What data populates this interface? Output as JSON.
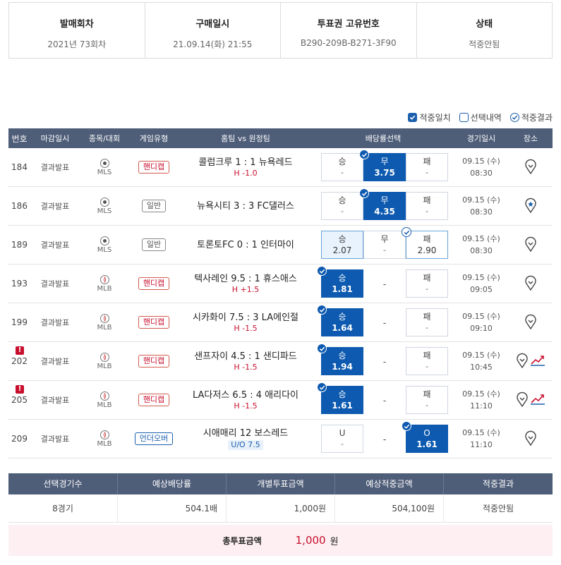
{
  "ticket": [
    {
      "label": "발매회차",
      "value": "2021년 73회차"
    },
    {
      "label": "구매일시",
      "value": "21.09.14(화) 21:55"
    },
    {
      "label": "투표권 고유번호",
      "value": "B290-209B-B271-3F90"
    },
    {
      "label": "상태",
      "value": "적중안됨"
    }
  ],
  "legend": {
    "match": "적중일치",
    "selection": "선택내역",
    "result": "적중결과"
  },
  "headers": {
    "no": "번호",
    "deadline": "마감일시",
    "sport": "종목/대회",
    "type": "게임유형",
    "match": "홈팀 vs 원정팀",
    "odds": "배당률선택",
    "time": "경기일시",
    "place": "장소"
  },
  "rows": [
    {
      "no": "184",
      "deadline": "결과발표",
      "league": "MLS",
      "type": "핸디캡",
      "match": "콜럼크루 1 : 1 뉴욕레드",
      "sub": "H -1.0",
      "o1": {
        "l": "승",
        "v": "-"
      },
      "o2": {
        "l": "무",
        "v": "3.75"
      },
      "o3": {
        "l": "패",
        "v": "-"
      },
      "date": "09.15 (수)",
      "time": "08:30"
    },
    {
      "no": "186",
      "deadline": "결과발표",
      "league": "MLS",
      "type": "일반",
      "match": "뉴욕시티 3 : 3 FC댈러스",
      "sub": "",
      "o1": {
        "l": "승",
        "v": "-"
      },
      "o2": {
        "l": "무",
        "v": "4.35"
      },
      "o3": {
        "l": "패",
        "v": "-"
      },
      "date": "09.15 (수)",
      "time": "08:30"
    },
    {
      "no": "189",
      "deadline": "결과발표",
      "league": "MLS",
      "type": "일반",
      "match": "토론토FC 0 : 1 인터마이",
      "sub": "",
      "o1": {
        "l": "승",
        "v": "2.07"
      },
      "o2": {
        "l": "무",
        "v": "-"
      },
      "o3": {
        "l": "패",
        "v": "2.90"
      },
      "date": "09.15 (수)",
      "time": "08:30"
    },
    {
      "no": "193",
      "deadline": "결과발표",
      "league": "MLB",
      "type": "핸디캡",
      "match": "텍사레인 9.5 : 1 휴스애스",
      "sub": "H +1.5",
      "o1": {
        "l": "승",
        "v": "1.81"
      },
      "o2": {
        "l": "",
        "v": "-"
      },
      "o3": {
        "l": "패",
        "v": "-"
      },
      "date": "09.15 (수)",
      "time": "09:05"
    },
    {
      "no": "199",
      "deadline": "결과발표",
      "league": "MLB",
      "type": "핸디캡",
      "match": "시카화이 7.5 : 3 LA에인절",
      "sub": "H -1.5",
      "o1": {
        "l": "승",
        "v": "1.64"
      },
      "o2": {
        "l": "",
        "v": "-"
      },
      "o3": {
        "l": "패",
        "v": "-"
      },
      "date": "09.15 (수)",
      "time": "09:10"
    },
    {
      "no": "202",
      "deadline": "결과발표",
      "league": "MLB",
      "type": "핸디캡",
      "match": "샌프자이 4.5 : 1 샌디파드",
      "sub": "H -1.5",
      "o1": {
        "l": "승",
        "v": "1.94"
      },
      "o2": {
        "l": "",
        "v": "-"
      },
      "o3": {
        "l": "패",
        "v": "-"
      },
      "date": "09.15 (수)",
      "time": "10:45"
    },
    {
      "no": "205",
      "deadline": "결과발표",
      "league": "MLB",
      "type": "핸디캡",
      "match": "LA다저스 6.5 : 4 애리다이",
      "sub": "H -1.5",
      "o1": {
        "l": "승",
        "v": "1.61"
      },
      "o2": {
        "l": "",
        "v": "-"
      },
      "o3": {
        "l": "패",
        "v": "-"
      },
      "date": "09.15 (수)",
      "time": "11:10"
    },
    {
      "no": "209",
      "deadline": "결과발표",
      "league": "MLB",
      "type": "언더오버",
      "match": "시애매리   12   보스레드",
      "sub": "U/O 7.5",
      "o1": {
        "l": "U",
        "v": "-"
      },
      "o2": {
        "l": "",
        "v": "-"
      },
      "o3": {
        "l": "O",
        "v": "1.61"
      },
      "date": "09.15 (수)",
      "time": "11:10"
    }
  ],
  "summary": {
    "headers": [
      "선택경기수",
      "예상배당률",
      "개별투표금액",
      "예상적중금액",
      "적중결과"
    ],
    "values": [
      "8경기",
      "504.1배",
      "1,000원",
      "504,100원",
      "적중안됨"
    ],
    "total_label": "총투표금액",
    "total_value": "1,000",
    "total_unit": "원"
  },
  "colors": {
    "header_bg": "#4e5d78",
    "selected": "#0d5ab0",
    "handicap": "#c8102e",
    "total_bg": "#fdeff2"
  }
}
